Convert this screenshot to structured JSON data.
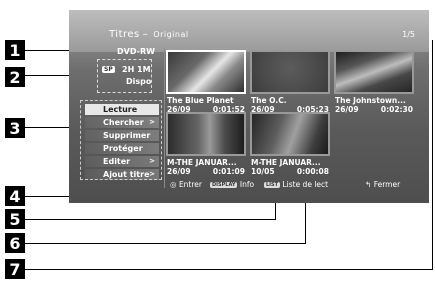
{
  "header": {
    "title": "Titres",
    "subtitle": "Original",
    "page": "1/5"
  },
  "disc": {
    "type": "DVD-RW",
    "mode": "SP",
    "remaining": "2H 1M",
    "available": "Dispo"
  },
  "menu": {
    "items": [
      {
        "label": "Lecture",
        "selected": true,
        "arrow": ""
      },
      {
        "label": "Chercher",
        "arrow": ">"
      },
      {
        "label": "Supprimer",
        "arrow": ""
      },
      {
        "label": "Protéger",
        "arrow": ""
      },
      {
        "label": "Editer",
        "arrow": ">"
      },
      {
        "label": "Ajout titre",
        "arrow": ">"
      }
    ]
  },
  "titles": [
    {
      "name": "The Blue Planet",
      "date": "26/09",
      "duration": "0:01:52",
      "selected": true
    },
    {
      "name": "The O.C.",
      "date": "26/09",
      "duration": "0:05:23"
    },
    {
      "name": "The Johnstown...",
      "date": "26/09",
      "duration": "0:02:30"
    },
    {
      "name": "M-THE JANUAR...",
      "date": "26/09",
      "duration": "0:01:09"
    },
    {
      "name": "M-THE JANUAR...",
      "date": "10/05",
      "duration": "0:00:08"
    }
  ],
  "footer": {
    "enter": "Entrer",
    "display_key": "DISPLAY",
    "info": "Info",
    "list_key": "LIST",
    "list": "Liste de lect",
    "close": "Fermer"
  },
  "callouts": [
    "1",
    "2",
    "3",
    "4",
    "5",
    "6",
    "7"
  ]
}
